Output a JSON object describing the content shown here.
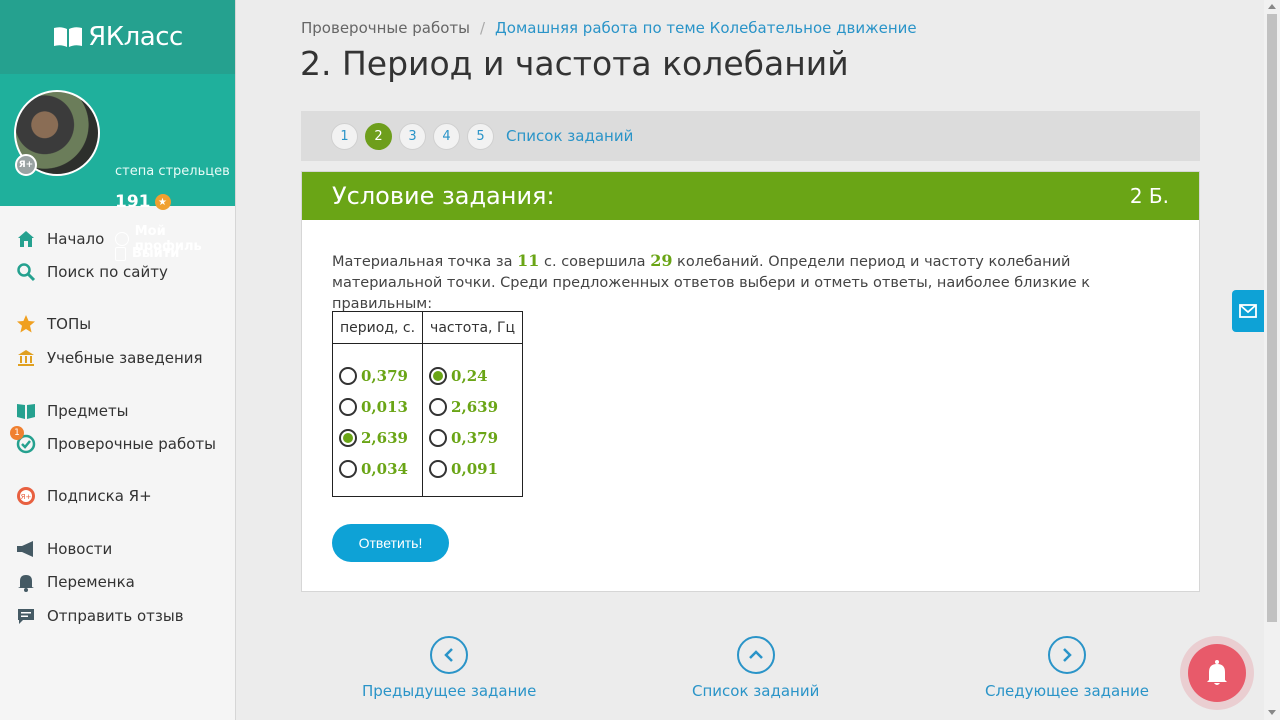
{
  "brand": {
    "logo_text": "ЯКласс"
  },
  "user": {
    "name": "степа стрельцев",
    "points": "191",
    "badge": "Я+",
    "profile_link": "Мой профиль",
    "logout_link": "Выйти"
  },
  "nav": {
    "items": [
      {
        "label": "Начало",
        "icon": "home-icon"
      },
      {
        "label": "Поиск по сайту",
        "icon": "search-icon"
      },
      {
        "label": "ТОПы",
        "icon": "star-icon"
      },
      {
        "label": "Учебные заведения",
        "icon": "building-icon"
      },
      {
        "label": "Предметы",
        "icon": "book-icon"
      },
      {
        "label": "Проверочные работы",
        "icon": "check-icon",
        "badge": "1"
      },
      {
        "label": "Подписка Я+",
        "icon": "yplus-icon"
      },
      {
        "label": "Новости",
        "icon": "megaphone-icon"
      },
      {
        "label": "Переменка",
        "icon": "bell-icon"
      },
      {
        "label": "Отправить отзыв",
        "icon": "feedback-icon"
      }
    ]
  },
  "breadcrumb": {
    "root": "Проверочные работы",
    "separator": "/",
    "current": "Домашняя работа по теме Колебательное движение"
  },
  "page_title": "2. Период и частота колебаний",
  "task_nav": {
    "numbers": [
      "1",
      "2",
      "3",
      "4",
      "5"
    ],
    "active": "2",
    "list_link": "Список заданий"
  },
  "task": {
    "header_title": "Условие задания:",
    "score": "2 Б.",
    "question_pre": "Материальная точка за ",
    "time_value": "11",
    "question_mid": " с. совершила ",
    "count_value": "29",
    "question_post": " колебаний. Определи период и частоту колебаний материальной точки. Среди предложенных ответов выбери и отметь ответы, наиболее близкие к правильным:",
    "table_headers": [
      "период, с.",
      "частота, Гц"
    ],
    "period_options": [
      {
        "value": "0,379",
        "checked": false
      },
      {
        "value": "0,013",
        "checked": false
      },
      {
        "value": "2,639",
        "checked": true
      },
      {
        "value": "0,034",
        "checked": false
      }
    ],
    "frequency_options": [
      {
        "value": "0,24",
        "checked": true
      },
      {
        "value": "2,639",
        "checked": false
      },
      {
        "value": "0,379",
        "checked": false
      },
      {
        "value": "0,091",
        "checked": false
      }
    ],
    "submit_label": "Ответить!"
  },
  "bottom_nav": {
    "prev": "Предыдущее задание",
    "list": "Список заданий",
    "next": "Следующее задание"
  },
  "colors": {
    "brand_teal": "#25a18f",
    "task_green": "#6aa516",
    "link_blue": "#2a94c8",
    "button_blue": "#0ea2d6"
  }
}
